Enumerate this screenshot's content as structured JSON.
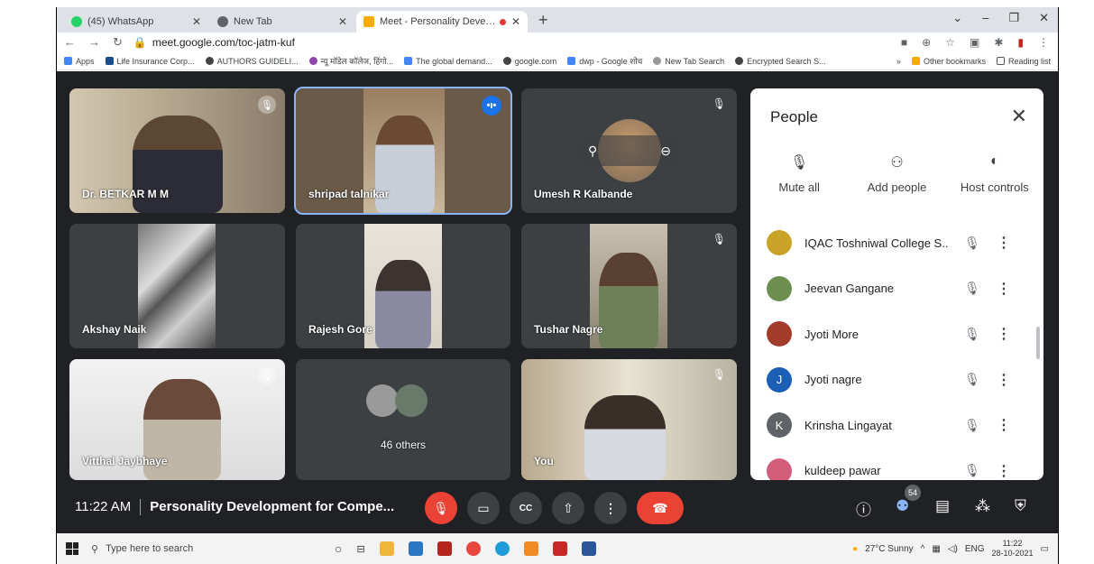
{
  "browser": {
    "tabs": [
      {
        "title": "(45) WhatsApp",
        "color": "#25d366"
      },
      {
        "title": "New Tab",
        "color": "#5f6368"
      },
      {
        "title": "Meet - Personality Developm",
        "color": "#f9ab00"
      }
    ],
    "url": "meet.google.com/toc-jatm-kuf",
    "bookmarks": [
      "Apps",
      "Life Insurance Corp...",
      "AUTHORS GUIDELI...",
      "न्यू मॉडेल कॉलेज, हिंगो...",
      "The global demand...",
      "google.com",
      "dwp - Google शोध",
      "New Tab Search",
      "Encrypted Search S..."
    ],
    "bookmarks_right": [
      "»",
      "Other bookmarks",
      "Reading list"
    ]
  },
  "meet": {
    "tiles": [
      {
        "name": "Dr. BETKAR M M"
      },
      {
        "name": "shripad talnikar"
      },
      {
        "name": "Umesh R Kalbande"
      },
      {
        "name": "Akshay Naik"
      },
      {
        "name": "Rajesh Gore"
      },
      {
        "name": "Tushar Nagre"
      },
      {
        "name": "Vitthal Jaybhaye"
      },
      {
        "name": "46 others"
      },
      {
        "name": "You"
      }
    ],
    "time": "11:22 AM",
    "meeting_title": "Personality Development for Compe...",
    "people_count": "54"
  },
  "people_panel": {
    "title": "People",
    "actions": [
      "Mute all",
      "Add people",
      "Host controls"
    ],
    "participants": [
      {
        "name": "IQAC Toshniwal College S...",
        "avatar": "",
        "color": "#c9a227"
      },
      {
        "name": "Jeevan Gangane",
        "avatar": "",
        "color": "#6d8f4e"
      },
      {
        "name": "Jyoti More",
        "avatar": "",
        "color": "#a33b2a"
      },
      {
        "name": "Jyoti nagre",
        "avatar": "J",
        "color": "#1a5fb4"
      },
      {
        "name": "Krinsha Lingayat",
        "avatar": "K",
        "color": "#5f6368"
      },
      {
        "name": "kuldeep pawar",
        "avatar": "",
        "color": "#d25d7a"
      }
    ]
  },
  "taskbar": {
    "search_placeholder": "Type here to search",
    "weather": "27°C  Sunny",
    "lang": "ENG",
    "time": "11:22",
    "date": "28-10-2021"
  }
}
